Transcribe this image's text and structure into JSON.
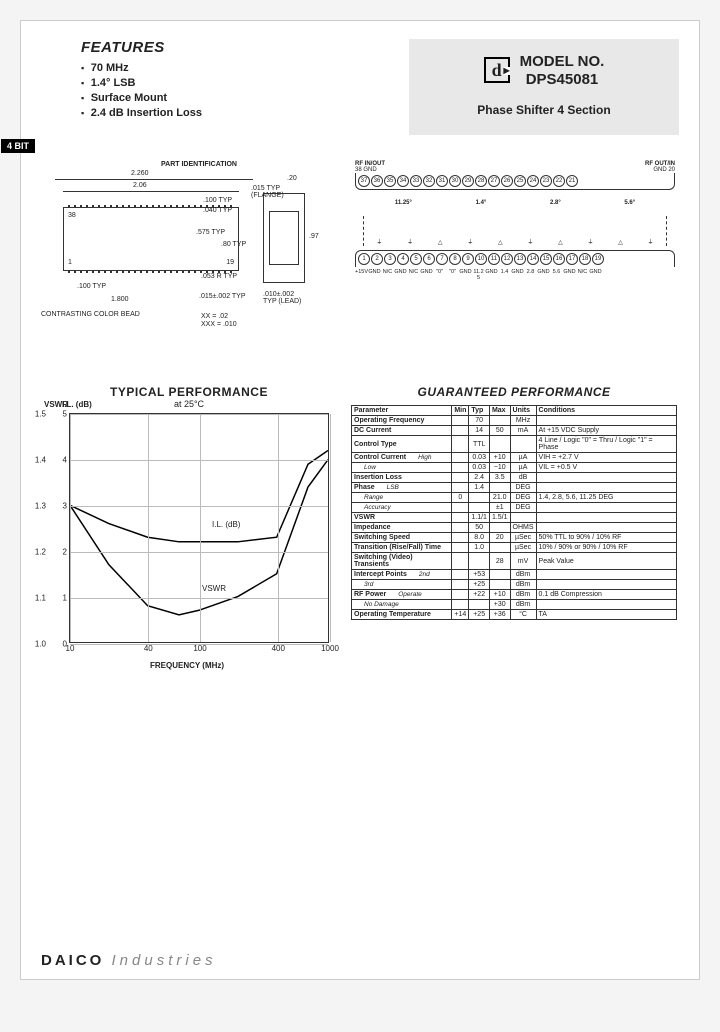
{
  "badge": "4 BIT",
  "features": {
    "heading": "FEATURES",
    "items": [
      "70 MHz",
      "1.4° LSB",
      "Surface Mount",
      "2.4 dB Insertion Loss"
    ]
  },
  "model_box": {
    "logo_letter": "d",
    "line1": "MODEL NO.",
    "line2": "DPS45081",
    "subtitle": "Phase Shifter 4 Section"
  },
  "package_drawing": {
    "title": "PART IDENTIFICATION",
    "dims": {
      "w_outer": "2.260",
      "w_inner": "2.06",
      "pitch": ".100 TYP",
      "lead_ext": ".040 TYP",
      "h_mid": ".575 TYP",
      "h_body": ".80 TYP",
      "r": ".053 R TYP",
      "bot_pitch": ".100 TYP",
      "bot_w": "1.800",
      "flange_w": ".20",
      "flange_t": ".015 TYP (FLANGE)",
      "flange_h": ".97",
      "edge_tol": ".015±.002 TYP",
      "lead_tol": ".010±.002 TYP (LEAD)",
      "bead": "CONTRASTING COLOR BEAD",
      "xx": "XX = .02",
      "xxx": "XXX = .010",
      "pin1": "1",
      "pin19": "19",
      "pin38": "38"
    }
  },
  "conn_diagram": {
    "rf_in": "RF IN/OUT",
    "rf_out": "RF OUT/IN",
    "gnd38": "38 GND",
    "gnd20": "GND 20",
    "top_pins": [
      "37",
      "36",
      "35",
      "34",
      "33",
      "32",
      "31",
      "30",
      "29",
      "28",
      "27",
      "26",
      "25",
      "24",
      "23",
      "22",
      "21"
    ],
    "sections": [
      "11.25°",
      "1.4°",
      "2.8°",
      "5.6°"
    ],
    "bot_pins": [
      "1",
      "2",
      "3",
      "4",
      "5",
      "6",
      "7",
      "8",
      "9",
      "10",
      "11",
      "12",
      "13",
      "14",
      "15",
      "16",
      "17",
      "18",
      "19"
    ],
    "bot_labels": [
      "+15V",
      "GND",
      "N/C",
      "GND",
      "N/C",
      "GND",
      "\"0\"",
      "\"0\"",
      "GND",
      "11.25",
      "GND",
      "1.4",
      "GND",
      "2.8",
      "GND",
      "5.6",
      "GND",
      "N/C",
      "GND"
    ]
  },
  "chart": {
    "title": "TYPICAL PERFORMANCE",
    "subtitle": "at 25°C",
    "xlabel": "FREQUENCY (MHz)",
    "y1label": "VSWR",
    "y2label": "I.L. (dB)",
    "xticks": [
      "10",
      "40",
      "100",
      "400",
      "1000"
    ],
    "y_vswr": [
      "1.0",
      "1.1",
      "1.2",
      "1.3",
      "1.4",
      "1.5"
    ],
    "y_il": [
      "0",
      "1",
      "2",
      "3",
      "4",
      "5"
    ],
    "curve1": "I.L. (dB)",
    "curve2": "VSWR"
  },
  "chart_data": {
    "type": "line",
    "xscale": "log",
    "xlim": [
      10,
      1000
    ],
    "series": [
      {
        "name": "VSWR",
        "yaxis": "left",
        "ylim": [
          1.0,
          1.5
        ],
        "x": [
          10,
          20,
          40,
          70,
          100,
          200,
          400,
          700,
          1000
        ],
        "y": [
          1.3,
          1.17,
          1.08,
          1.06,
          1.07,
          1.1,
          1.15,
          1.34,
          1.4
        ]
      },
      {
        "name": "I.L. (dB)",
        "yaxis": "right",
        "ylim": [
          0,
          5
        ],
        "x": [
          10,
          20,
          40,
          70,
          100,
          200,
          400,
          700,
          1000
        ],
        "y": [
          3.0,
          2.6,
          2.3,
          2.2,
          2.2,
          2.2,
          2.3,
          3.9,
          4.2
        ]
      }
    ]
  },
  "perf_table": {
    "title": "GUARANTEED PERFORMANCE",
    "headers": [
      "Parameter",
      "Min",
      "Typ",
      "Max",
      "Units",
      "Conditions"
    ],
    "rows": [
      {
        "p": "Operating Frequency",
        "min": "",
        "typ": "70",
        "max": "",
        "u": "MHz",
        "c": ""
      },
      {
        "p": "DC Current",
        "min": "",
        "typ": "14",
        "max": "50",
        "u": "mA",
        "c": "At +15 VDC Supply"
      },
      {
        "p": "Control Type",
        "min": "",
        "typ": "TTL",
        "max": "",
        "u": "",
        "c": "4 Line / Logic \"0\" = Thru / Logic \"1\" = Phase"
      },
      {
        "p": "Control Current",
        "sub": "High",
        "min": "",
        "typ": "0.03",
        "max": "+10",
        "u": "µA",
        "c": "VIH = +2.7 V"
      },
      {
        "p": "",
        "sub": "Low",
        "min": "",
        "typ": "0.03",
        "max": "−10",
        "u": "µA",
        "c": "VIL = +0.5 V"
      },
      {
        "p": "Insertion Loss",
        "min": "",
        "typ": "2.4",
        "max": "3.5",
        "u": "dB",
        "c": ""
      },
      {
        "p": "Phase",
        "sub": "LSB",
        "min": "",
        "typ": "1.4",
        "max": "",
        "u": "DEG",
        "c": ""
      },
      {
        "p": "",
        "sub": "Range",
        "min": "0",
        "typ": "",
        "max": "21.0",
        "u": "DEG",
        "c": "1.4, 2.8, 5.6, 11.25 DEG"
      },
      {
        "p": "",
        "sub": "Accuracy",
        "min": "",
        "typ": "",
        "max": "±1",
        "u": "DEG",
        "c": ""
      },
      {
        "p": "VSWR",
        "min": "",
        "typ": "1.1/1",
        "max": "1.5/1",
        "u": "",
        "c": ""
      },
      {
        "p": "Impedance",
        "min": "",
        "typ": "50",
        "max": "",
        "u": "OHMS",
        "c": ""
      },
      {
        "p": "Switching Speed",
        "min": "",
        "typ": "8.0",
        "max": "20",
        "u": "µSec",
        "c": "50% TTL to 90% / 10% RF"
      },
      {
        "p": "Transition (Rise/Fall) Time",
        "min": "",
        "typ": "1.0",
        "max": "",
        "u": "µSec",
        "c": "10% / 90% or 90% / 10% RF"
      },
      {
        "p": "Switching (Video) Transients",
        "min": "",
        "typ": "",
        "max": "28",
        "u": "mV",
        "c": "Peak Value"
      },
      {
        "p": "Intercept Points",
        "sub": "2nd",
        "min": "",
        "typ": "+53",
        "max": "",
        "u": "dBm",
        "c": ""
      },
      {
        "p": "",
        "sub": "3rd",
        "min": "",
        "typ": "+25",
        "max": "",
        "u": "dBm",
        "c": ""
      },
      {
        "p": "RF Power",
        "sub": "Operate",
        "min": "",
        "typ": "+22",
        "max": "+10",
        "u": "dBm",
        "c": "0.1 dB Compression"
      },
      {
        "p": "",
        "sub": "No Damage",
        "min": "",
        "typ": "",
        "max": "+30",
        "u": "dBm",
        "c": ""
      },
      {
        "p": "Operating Temperature",
        "min": "+14",
        "typ": "+25",
        "max": "+36",
        "u": "°C",
        "c": "TA"
      }
    ]
  },
  "footer": {
    "brand_bold": "DAICO",
    "brand_light": "Industries",
    "page": ""
  }
}
